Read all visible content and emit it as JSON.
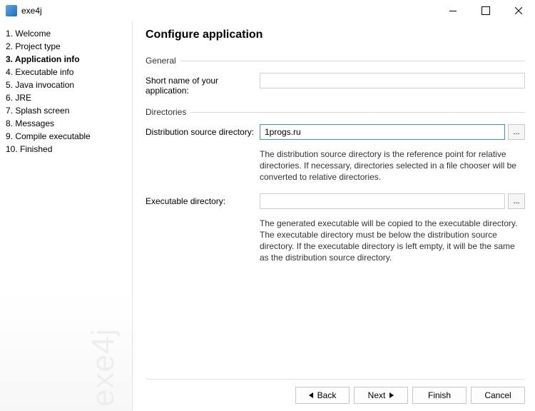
{
  "window": {
    "title": "exe4j"
  },
  "sidebar": {
    "watermark": "exe4j",
    "steps": [
      {
        "label": "1. Welcome"
      },
      {
        "label": "2. Project type"
      },
      {
        "label": "3. Application info",
        "current": true
      },
      {
        "label": "4. Executable info"
      },
      {
        "label": "5. Java invocation"
      },
      {
        "label": "6. JRE"
      },
      {
        "label": "7. Splash screen"
      },
      {
        "label": "8. Messages"
      },
      {
        "label": "9. Compile executable"
      },
      {
        "label": "10. Finished"
      }
    ]
  },
  "heading": "Configure application",
  "sections": {
    "general": {
      "title": "General",
      "short_name_label": "Short name of your application:",
      "short_name_value": ""
    },
    "directories": {
      "title": "Directories",
      "dist_label": "Distribution source directory:",
      "dist_value": "1progs.ru",
      "dist_desc": "The distribution source directory is the reference point for relative directories. If necessary, directories selected in a file chooser will be converted to relative directories.",
      "exec_label": "Executable directory:",
      "exec_value": "",
      "exec_desc": "The generated executable will be copied to the executable directory. The executable directory must be below the distribution source directory. If the executable directory is left empty, it will be the same as the distribution source directory.",
      "browse_label": "..."
    }
  },
  "footer": {
    "back": "Back",
    "next": "Next",
    "finish": "Finish",
    "cancel": "Cancel"
  }
}
